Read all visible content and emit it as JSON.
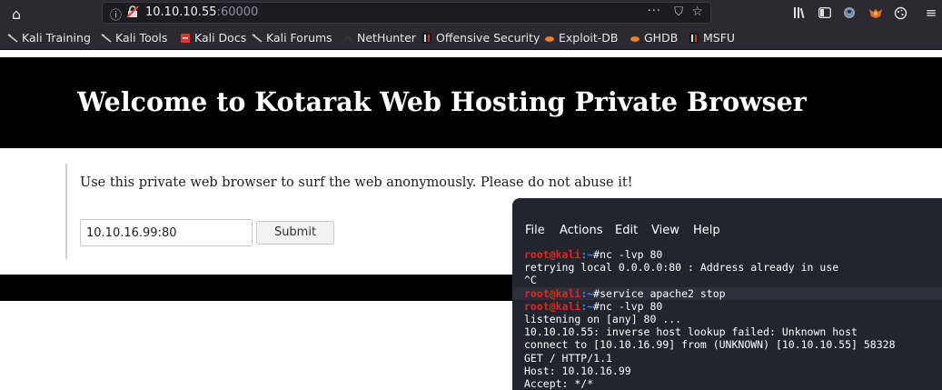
{
  "browser": {
    "url_host": "10.10.10.55",
    "url_port": ":60000",
    "page_actions": "···",
    "bookmarks": [
      {
        "label": "Kali Training",
        "icon": "kali-dragon-icon"
      },
      {
        "label": "Kali Tools",
        "icon": "kali-dragon-icon"
      },
      {
        "label": "Kali Docs",
        "icon": "kali-docs-icon"
      },
      {
        "label": "Kali Forums",
        "icon": "kali-dragon-icon"
      },
      {
        "label": "NetHunter",
        "icon": "nethunter-icon"
      },
      {
        "label": "Offensive Security",
        "icon": "offsec-icon"
      },
      {
        "label": "Exploit-DB",
        "icon": "exploitdb-icon"
      },
      {
        "label": "GHDB",
        "icon": "exploitdb-icon"
      },
      {
        "label": "MSFU",
        "icon": "offsec-icon"
      }
    ]
  },
  "page": {
    "title": "Welcome to Kotarak Web Hosting Private Browser",
    "intro": "Use this private web browser to surf the web anonymously. Please do not abuse it!",
    "input_value": "10.10.16.99:80",
    "submit_label": "Submit"
  },
  "terminal": {
    "menu": [
      "File",
      "Actions",
      "Edit",
      "View",
      "Help"
    ],
    "prompt_user": "root@kali",
    "prompt_sep": ":~",
    "lines": [
      {
        "type": "prompt",
        "cmd": "#nc -lvp 80"
      },
      {
        "type": "out",
        "text": "retrying local 0.0.0.0:80 : Address already in use"
      },
      {
        "type": "out",
        "text": "^C"
      },
      {
        "type": "prompt",
        "cmd": "#service apache2 stop"
      },
      {
        "type": "prompt",
        "cmd": "#nc -lvp 80"
      },
      {
        "type": "out",
        "text": "listening on [any] 80 ..."
      },
      {
        "type": "out",
        "text": "10.10.10.55: inverse host lookup failed: Unknown host"
      },
      {
        "type": "out",
        "text": "connect to [10.10.16.99] from (UNKNOWN) [10.10.10.55] 58328"
      },
      {
        "type": "out",
        "text": "GET / HTTP/1.1"
      },
      {
        "type": "out",
        "text": "Host: 10.10.16.99"
      },
      {
        "type": "out",
        "text": "Accept: */*"
      }
    ]
  },
  "colors": {
    "chrome_bg": "#2b2a33",
    "hero_bg": "#000000",
    "terminal_bg": "#23252e",
    "prompt_user": "#e0261f",
    "prompt_path": "#3d82e8"
  }
}
